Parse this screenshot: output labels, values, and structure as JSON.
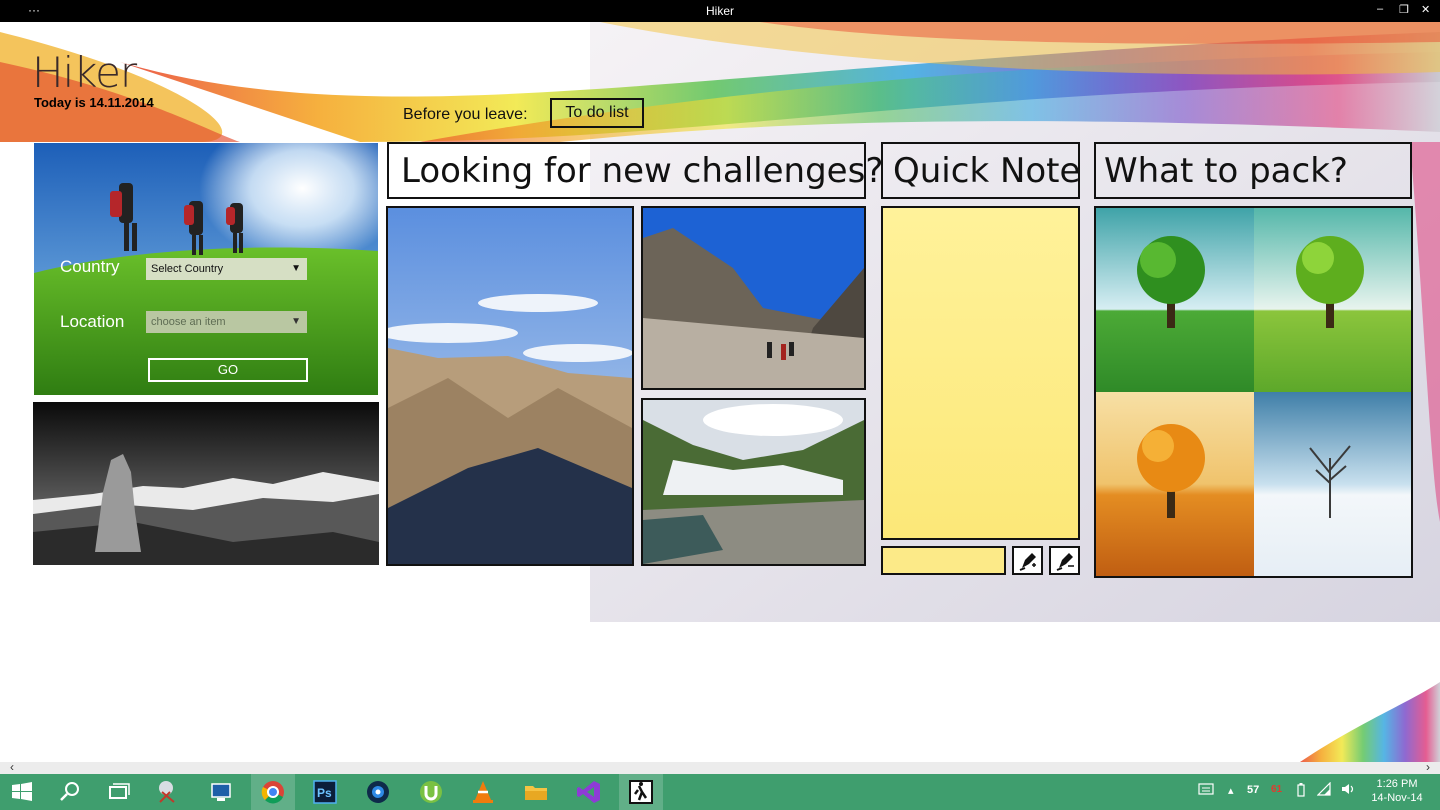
{
  "window": {
    "title": "Hiker",
    "menu_dots": "···",
    "minimize": "–",
    "restore": "❐",
    "close": "✕"
  },
  "app": {
    "name": "Hiker",
    "today": "Today is 14.11.2014",
    "before_label": "Before you leave:",
    "todo_button": "To do list"
  },
  "search": {
    "country_label": "Country",
    "country_value": "Select Country",
    "location_label": "Location",
    "location_placeholder": "choose an item",
    "go_button": "GO"
  },
  "headers": {
    "challenges": "Looking for new challenges?",
    "quick_note": "Quick Note",
    "what_to_pack": "What to pack?"
  },
  "taskbar": {
    "icons": [
      "windows-start-icon",
      "search-icon",
      "task-view-icon",
      "snipping-tool-icon",
      "remote-desktop-icon",
      "chrome-icon",
      "photoshop-icon",
      "camera-app-icon",
      "utorrent-icon",
      "vlc-icon",
      "file-explorer-icon",
      "visual-studio-icon",
      "hiker-app-icon"
    ],
    "photoshop_text": "Ps",
    "tray_a": "57",
    "tray_b": "61",
    "time": "1:26 PM",
    "date": "14-Nov-14"
  },
  "colors": {
    "taskbar": "#3f9e6e",
    "note": "#fcea88",
    "titlebar": "#000000"
  }
}
